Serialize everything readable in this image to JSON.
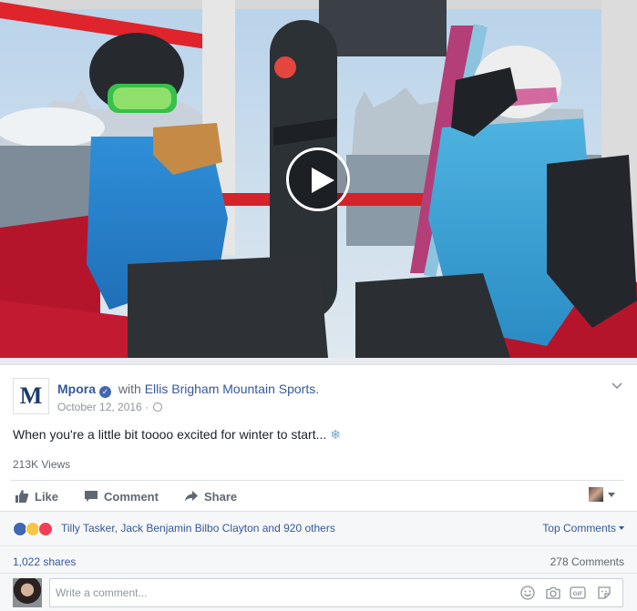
{
  "post": {
    "page_name": "Mpora",
    "logo_letter": "M",
    "with_text": "with",
    "tagged_page": "Ellis Brigham Mountain Sports.",
    "date": "October 12, 2016",
    "separator": "·",
    "text": "When you're a little bit toooo excited for winter to start...",
    "emoji": "❄",
    "views": "213K Views"
  },
  "actions": {
    "like": "Like",
    "comment": "Comment",
    "share": "Share"
  },
  "reactions": {
    "names": "Tilly Tasker, Jack Benjamin Bilbo Clayton and 920 others",
    "sort": "Top Comments"
  },
  "stats": {
    "shares": "1,022 shares",
    "comments": "278 Comments"
  },
  "composer": {
    "placeholder": "Write a comment..."
  },
  "colors": {
    "link": "#365899",
    "brand": "#4267b2",
    "background": "#e9ebee"
  },
  "icons": [
    "play-icon",
    "verified-icon",
    "globe-icon",
    "chevron-down-icon",
    "like-icon",
    "comment-icon",
    "share-icon",
    "emoji-icon",
    "camera-icon",
    "gif-icon",
    "sticker-icon"
  ]
}
